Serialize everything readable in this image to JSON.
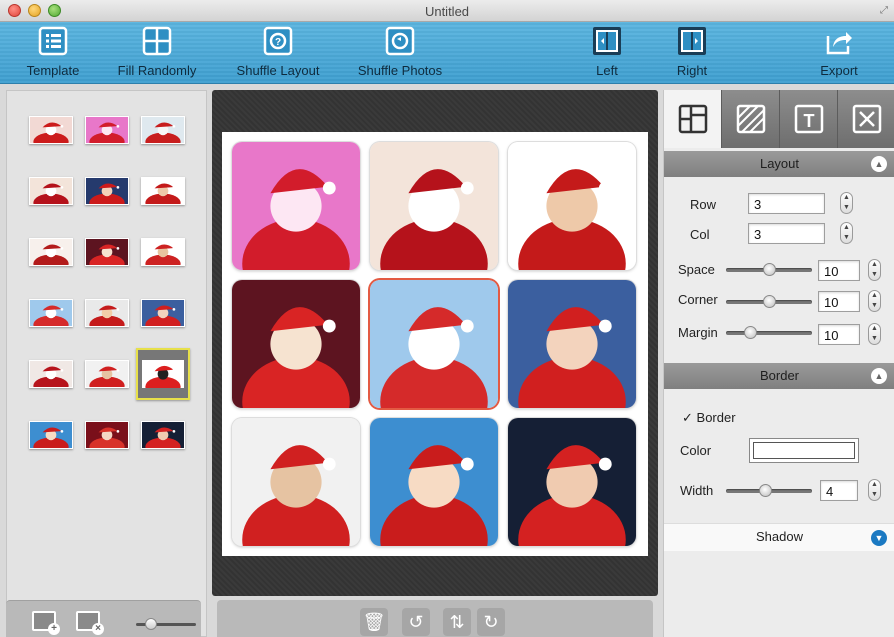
{
  "window": {
    "title": "Untitled"
  },
  "toolbar": {
    "template": "Template",
    "fill_randomly": "Fill Randomly",
    "shuffle_layout": "Shuffle Layout",
    "shuffle_photos": "Shuffle Photos",
    "left": "Left",
    "right": "Right",
    "export": "Export"
  },
  "photo_library": {
    "thumbnail_count": 18,
    "selected_index": 14,
    "thumb_size_level": 0.2
  },
  "collage": {
    "rows": 3,
    "cols": 3,
    "active_cell": 4
  },
  "inspector": {
    "tabs": [
      "layout-tab",
      "background-tab",
      "text-tab",
      "clear-tab"
    ],
    "active_tab": 0,
    "layout": {
      "header": "Layout",
      "row_label": "Row",
      "row_value": "3",
      "col_label": "Col",
      "col_value": "3",
      "space_label": "Space",
      "space_value": "10",
      "space_level": 0.5,
      "corner_label": "Corner",
      "corner_value": "10",
      "corner_level": 0.5,
      "margin_label": "Margin",
      "margin_value": "10",
      "margin_level": 0.25
    },
    "border": {
      "header": "Border",
      "checkbox_label": "Border",
      "checked": true,
      "color_label": "Color",
      "color_value": "#ffffff",
      "width_label": "Width",
      "width_value": "4",
      "width_level": 0.45
    },
    "shadow": {
      "header": "Shadow"
    }
  },
  "colors": {
    "toolbar": "#4aa9d8",
    "accent_blue": "#1b79c2",
    "selection": "#e7e04a",
    "active_cell": "#e35a43"
  }
}
